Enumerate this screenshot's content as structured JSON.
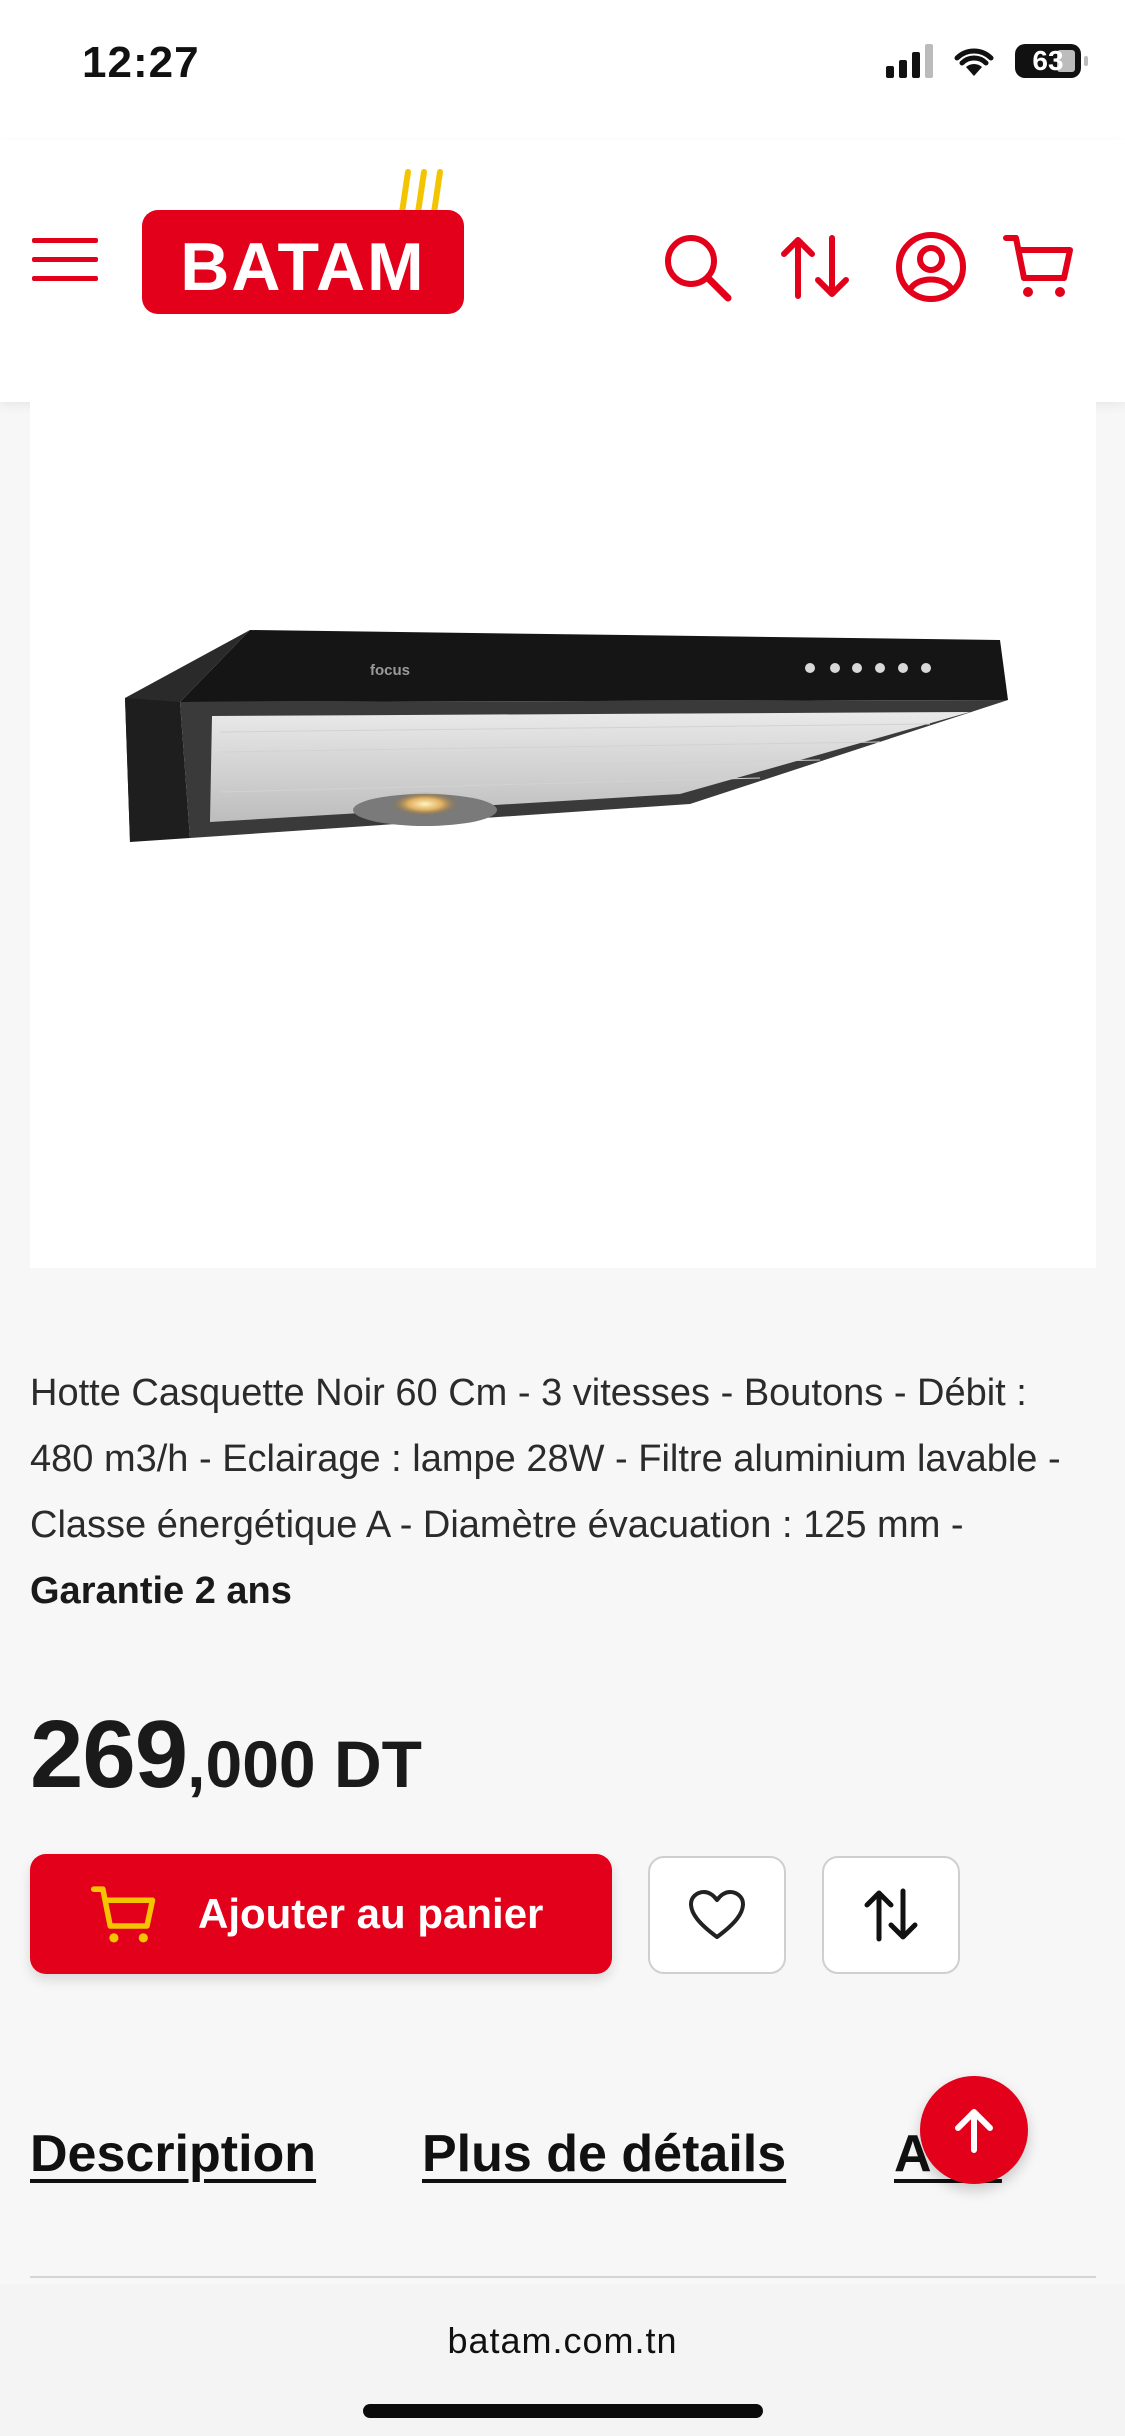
{
  "status_bar": {
    "time": "12:27",
    "battery": "63",
    "icons": [
      "signal-icon",
      "wifi-icon",
      "battery-icon"
    ]
  },
  "header": {
    "logo_text": "BATAM",
    "icons": [
      "menu-icon",
      "search-icon",
      "compare-icon",
      "account-icon",
      "cart-icon"
    ]
  },
  "product": {
    "brand_on_image": "focus",
    "description_text": "Hotte Casquette Noir 60 Cm - 3 vitesses - Boutons - Débit : 480 m3/h - Eclairage : lampe 28W - Filtre aluminium lavable - Classe énergétique A - Diamètre évacuation : 125 mm - ",
    "description_bold": "Garantie 2 ans",
    "price_int": "269",
    "price_dec": ",000 DT"
  },
  "actions": {
    "add_to_cart_label": "Ajouter au panier",
    "wishlist_icon": "heart-icon",
    "compare_icon": "compare-icon"
  },
  "tabs": [
    {
      "label": "Description"
    },
    {
      "label": "Plus de détails"
    },
    {
      "label": "Avis"
    }
  ],
  "browser": {
    "url": "batam.com.tn"
  },
  "colors": {
    "brand_red": "#e2001a",
    "logo_accent": "#f5c400"
  }
}
